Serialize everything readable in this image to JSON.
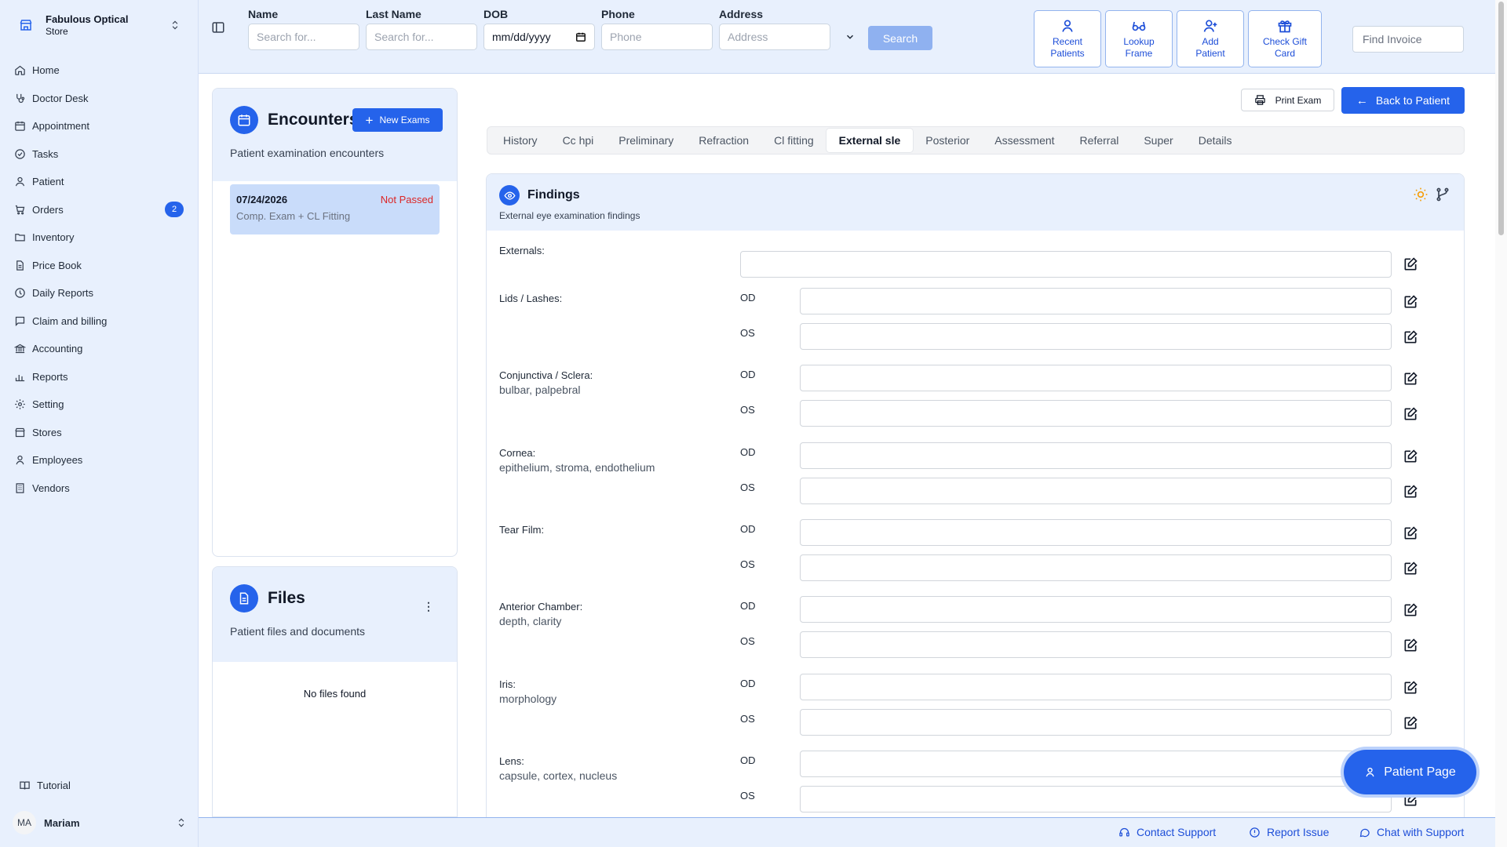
{
  "store": {
    "name": "Fabulous Optical",
    "sub": "Store"
  },
  "nav": [
    {
      "label": "Home",
      "icon": "home-icon"
    },
    {
      "label": "Doctor Desk",
      "icon": "stethoscope-icon"
    },
    {
      "label": "Appointment",
      "icon": "calendar-icon"
    },
    {
      "label": "Tasks",
      "icon": "check-circle-icon"
    },
    {
      "label": "Patient",
      "icon": "patient-icon"
    },
    {
      "label": "Orders",
      "icon": "cart-icon",
      "badge": "2"
    },
    {
      "label": "Inventory",
      "icon": "folder-icon"
    },
    {
      "label": "Price Book",
      "icon": "file-icon"
    },
    {
      "label": "Daily Reports",
      "icon": "clock-icon"
    },
    {
      "label": "Claim and billing",
      "icon": "message-icon"
    },
    {
      "label": "Accounting",
      "icon": "bank-icon"
    },
    {
      "label": "Reports",
      "icon": "bar-chart-icon"
    },
    {
      "label": "Setting",
      "icon": "gear-icon"
    },
    {
      "label": "Stores",
      "icon": "store-icon"
    },
    {
      "label": "Employees",
      "icon": "user-icon"
    },
    {
      "label": "Vendors",
      "icon": "building-icon"
    }
  ],
  "tutorial": "Tutorial",
  "user": {
    "initials": "MA",
    "name": "Mariam"
  },
  "search": {
    "name_label": "Name",
    "name_placeholder": "Search for...",
    "last_label": "Last Name",
    "last_placeholder": "Search for...",
    "dob_label": "DOB",
    "dob_value": "mm/dd/yyyy",
    "phone_label": "Phone",
    "phone_placeholder": "Phone",
    "address_label": "Address",
    "address_placeholder": "Address",
    "button": "Search"
  },
  "quick_actions": [
    {
      "line1": "Recent",
      "line2": "Patients"
    },
    {
      "line1": "Lookup",
      "line2": "Frame"
    },
    {
      "line1": "Add",
      "line2": "Patient"
    },
    {
      "line1": "Check Gift",
      "line2": "Card"
    }
  ],
  "find_invoice_placeholder": "Find Invoice",
  "encounters": {
    "title": "Encounters",
    "subtitle": "Patient examination encounters",
    "new_button": "New Exams",
    "items": [
      {
        "date": "07/24/2026",
        "status": "Not Passed",
        "desc": "Comp. Exam + CL Fitting"
      }
    ]
  },
  "files": {
    "title": "Files",
    "subtitle": "Patient files and documents",
    "empty": "No files found"
  },
  "actions": {
    "print": "Print Exam",
    "back": "Back to Patient"
  },
  "tabs": [
    "History",
    "Cc hpi",
    "Preliminary",
    "Refraction",
    "Cl fitting",
    "External sle",
    "Posterior",
    "Assessment",
    "Referral",
    "Super",
    "Details"
  ],
  "active_tab": "External sle",
  "findings": {
    "title": "Findings",
    "subtitle": "External eye examination findings",
    "od": "OD",
    "os": "OS",
    "rows": [
      {
        "label": "Externals:",
        "sub": ""
      },
      {
        "label": "Lids / Lashes:",
        "sub": ""
      },
      {
        "label": "Conjunctiva / Sclera:",
        "sub": "bulbar, palpebral"
      },
      {
        "label": "Cornea:",
        "sub": "epithelium, stroma, endothelium"
      },
      {
        "label": "Tear Film:",
        "sub": ""
      },
      {
        "label": "Anterior Chamber:",
        "sub": "depth, clarity"
      },
      {
        "label": "Iris:",
        "sub": "morphology"
      },
      {
        "label": "Lens:",
        "sub": "capsule, cortex, nucleus"
      }
    ]
  },
  "patient_page": "Patient Page",
  "footer": {
    "contact": "Contact Support",
    "report": "Report Issue",
    "chat": "Chat with Support"
  },
  "colors": {
    "accent": "#2563eb",
    "panel_bg": "#e8f0fd",
    "danger": "#dc2626"
  }
}
